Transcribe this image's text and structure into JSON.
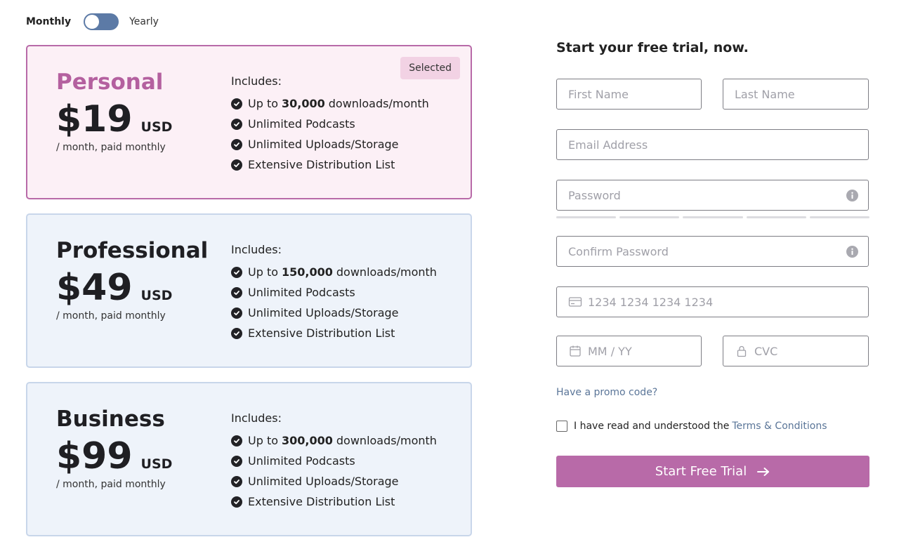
{
  "toggle": {
    "monthly_label": "Monthly",
    "yearly_label": "Yearly"
  },
  "plans": [
    {
      "name": "Personal",
      "price": "$19",
      "currency": "USD",
      "billing": "/ month, paid monthly",
      "badge": "Selected",
      "includes": "Includes:",
      "features": [
        {
          "prefix": "Up to",
          "bold": "30,000",
          "suffix": "downloads/month"
        },
        {
          "text": "Unlimited Podcasts"
        },
        {
          "text": "Unlimited Uploads/Storage"
        },
        {
          "text": "Extensive Distribution List"
        }
      ]
    },
    {
      "name": "Professional",
      "price": "$49",
      "currency": "USD",
      "billing": "/ month, paid monthly",
      "includes": "Includes:",
      "features": [
        {
          "prefix": "Up to",
          "bold": "150,000",
          "suffix": "downloads/month"
        },
        {
          "text": "Unlimited Podcasts"
        },
        {
          "text": "Unlimited Uploads/Storage"
        },
        {
          "text": "Extensive Distribution List"
        }
      ]
    },
    {
      "name": "Business",
      "price": "$99",
      "currency": "USD",
      "billing": "/ month, paid monthly",
      "includes": "Includes:",
      "features": [
        {
          "prefix": "Up to",
          "bold": "300,000",
          "suffix": "downloads/month"
        },
        {
          "text": "Unlimited Podcasts"
        },
        {
          "text": "Unlimited Uploads/Storage"
        },
        {
          "text": "Extensive Distribution List"
        }
      ]
    }
  ],
  "form": {
    "title": "Start your free trial, now.",
    "first_name_placeholder": "First Name",
    "last_name_placeholder": "Last Name",
    "email_placeholder": "Email Address",
    "password_placeholder": "Password",
    "confirm_password_placeholder": "Confirm Password",
    "card_number_placeholder": "1234 1234 1234 1234",
    "expiry_placeholder": "MM / YY",
    "cvc_placeholder": "CVC",
    "promo_link": "Have a promo code?",
    "terms_prefix": "I have read and understood the",
    "terms_link": "Terms & Conditions",
    "submit_label": "Start Free Trial"
  },
  "colors": {
    "accent": "#b86aa8",
    "link": "#5a7598",
    "selected_card_bg": "#fcf0f6",
    "card_bg": "#eef3fa",
    "toggle": "#5c7aa6"
  }
}
